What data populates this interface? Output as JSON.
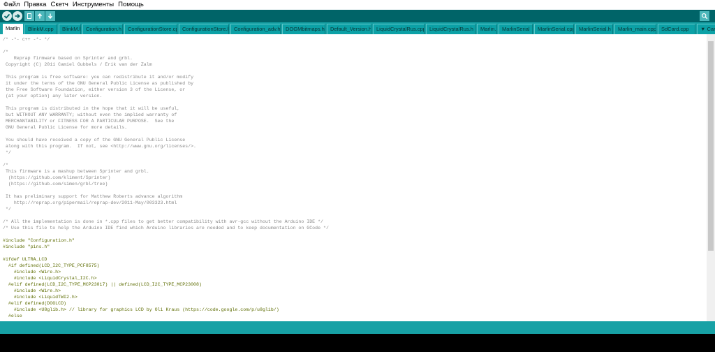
{
  "menu": [
    "Файл",
    "Правка",
    "Скетч",
    "Инструменты",
    "Помощь"
  ],
  "toolbar": {
    "buttons": [
      "verify",
      "upload",
      "new",
      "open",
      "save"
    ],
    "serial_monitor": "serial-monitor"
  },
  "tabs": [
    {
      "label": "Marlin",
      "active": true
    },
    {
      "label": "BlinkM.cpp"
    },
    {
      "label": "BlinkM.h"
    },
    {
      "label": "Configuration.h"
    },
    {
      "label": "ConfigurationStore.cpp"
    },
    {
      "label": "ConfigurationStore.h"
    },
    {
      "label": "Configuration_adv.h"
    },
    {
      "label": "DOGMbitmaps.h"
    },
    {
      "label": "Default_Version.h"
    },
    {
      "label": "LiquidCrystalRus.cpp"
    },
    {
      "label": "LiquidCrystalRus.h"
    },
    {
      "label": "Marlin.h"
    },
    {
      "label": "MarlinSerial"
    },
    {
      "label": "MarlinSerial.cpp"
    },
    {
      "label": "MarlinSerial.h"
    },
    {
      "label": "Marlin_main.cpp"
    },
    {
      "label": "SdCard.cpp"
    },
    {
      "label": "▼ Car"
    }
  ],
  "code": [
    {
      "text": "/* -*- c++ -*- */",
      "kind": "comment"
    },
    {
      "text": "",
      "kind": "plain"
    },
    {
      "text": "/*",
      "kind": "comment"
    },
    {
      "text": "    Reprap firmware based on Sprinter and grbl.",
      "kind": "comment"
    },
    {
      "text": " Copyright (C) 2011 Camiel Gubbels / Erik van der Zalm",
      "kind": "comment"
    },
    {
      "text": "",
      "kind": "plain"
    },
    {
      "text": " This program is free software: you can redistribute it and/or modify",
      "kind": "comment"
    },
    {
      "text": " it under the terms of the GNU General Public License as published by",
      "kind": "comment"
    },
    {
      "text": " the Free Software Foundation, either version 3 of the License, or",
      "kind": "comment"
    },
    {
      "text": " (at your option) any later version.",
      "kind": "comment"
    },
    {
      "text": "",
      "kind": "plain"
    },
    {
      "text": " This program is distributed in the hope that it will be useful,",
      "kind": "comment"
    },
    {
      "text": " but WITHOUT ANY WARRANTY; without even the implied warranty of",
      "kind": "comment"
    },
    {
      "text": " MERCHANTABILITY or FITNESS FOR A PARTICULAR PURPOSE.  See the",
      "kind": "comment"
    },
    {
      "text": " GNU General Public License for more details.",
      "kind": "comment"
    },
    {
      "text": "",
      "kind": "plain"
    },
    {
      "text": " You should have received a copy of the GNU General Public License",
      "kind": "comment"
    },
    {
      "text": " along with this program.  If not, see <http://www.gnu.org/licenses/>.",
      "kind": "comment"
    },
    {
      "text": " */",
      "kind": "comment"
    },
    {
      "text": "",
      "kind": "plain"
    },
    {
      "text": "/*",
      "kind": "comment"
    },
    {
      "text": " This firmware is a mashup between Sprinter and grbl.",
      "kind": "comment"
    },
    {
      "text": "  (https://github.com/kliment/Sprinter)",
      "kind": "comment"
    },
    {
      "text": "  (https://github.com/simen/grbl/tree)",
      "kind": "comment"
    },
    {
      "text": "",
      "kind": "plain"
    },
    {
      "text": " It has preliminary support for Matthew Roberts advance algorithm",
      "kind": "comment"
    },
    {
      "text": "    http://reprap.org/pipermail/reprap-dev/2011-May/003323.html",
      "kind": "comment"
    },
    {
      "text": " */",
      "kind": "comment"
    },
    {
      "text": "",
      "kind": "plain"
    },
    {
      "text": "/* All the implementation is done in *.cpp files to get better compatibility with avr-gcc without the Arduino IDE */",
      "kind": "comment"
    },
    {
      "text": "/* Use this file to help the Arduino IDE find which Arduino libraries are needed and to keep documentation on GCode */",
      "kind": "comment"
    },
    {
      "text": "",
      "kind": "plain"
    },
    {
      "text": "#include \"Configuration.h\"",
      "kind": "directive"
    },
    {
      "text": "#include \"pins.h\"",
      "kind": "directive"
    },
    {
      "text": "",
      "kind": "plain"
    },
    {
      "text": "#ifdef ULTRA_LCD",
      "kind": "directive"
    },
    {
      "text": "  #if defined(LCD_I2C_TYPE_PCF8575)",
      "kind": "directive"
    },
    {
      "text": "    #include <Wire.h>",
      "kind": "directive"
    },
    {
      "text": "    #include <LiquidCrystal_I2C.h>",
      "kind": "directive"
    },
    {
      "text": "  #elif defined(LCD_I2C_TYPE_MCP23017) || defined(LCD_I2C_TYPE_MCP23008)",
      "kind": "directive"
    },
    {
      "text": "    #include <Wire.h>",
      "kind": "directive"
    },
    {
      "text": "    #include <LiquidTWI2.h>",
      "kind": "directive"
    },
    {
      "text": "  #elif defined(DOGLCD)",
      "kind": "directive"
    },
    {
      "text": "    #include <U8glib.h> // library for graphics LCD by Oli Kraus (https://code.google.com/p/u8glib/)",
      "kind": "directive"
    },
    {
      "text": "  #else",
      "kind": "directive"
    }
  ]
}
